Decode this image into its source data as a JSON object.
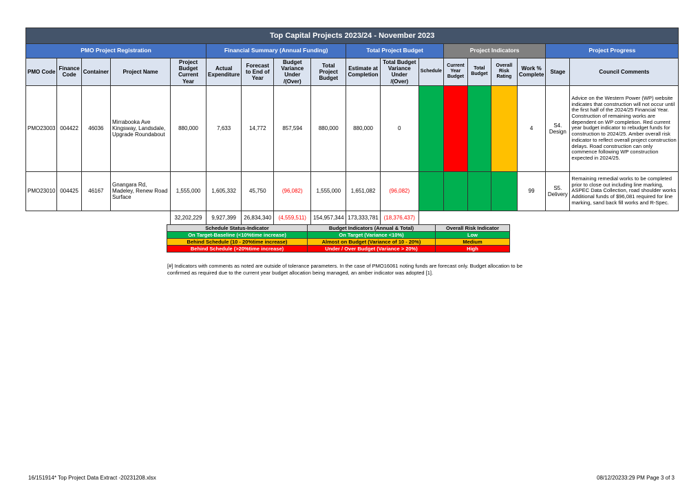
{
  "report": {
    "title": "Top Capital Projects 2023/24 - November 2023"
  },
  "groups": {
    "registration": "PMO Project Registration",
    "financial": "Financial Summary (Annual Funding)",
    "total_budget": "Total Project Budget",
    "indicators": "Project Indicators",
    "progress": "Project Progress"
  },
  "columns": {
    "pmo_code": "PMO Code",
    "finance_code": "Finance Code",
    "container": "Container",
    "project_name": "Project Name",
    "project_budget": "Project Budget Current Year",
    "actual_expenditure": "Actual Expenditure",
    "forecast": "Forecast to End of Year",
    "budget_variance": "Budget Variance Under /(Over)",
    "total_project_budget": "Total Project Budget",
    "estimate_completion": "Estimate at Completion",
    "total_budget_variance": "Total Budget Variance Under /(Over)",
    "schedule": "Schedule",
    "current_year_budget": "Current Year Budget",
    "total_budget": "Total Budget",
    "overall_risk": "Overall Risk Rating",
    "work_complete": "Work % Complete",
    "stage": "Stage",
    "council_comments": "Council Comments"
  },
  "colors": {
    "green": "#00b050",
    "red": "#ff0000",
    "amber": "#ffc000",
    "title_bg": "#44546a",
    "group_blue": "#4472c4",
    "group_grey": "#808080"
  },
  "rows": [
    {
      "pmo_code": "PMO23003",
      "finance_code": "004422",
      "container": "46036",
      "project_name": "Mirrabooka Ave Kingsway, Landsdale, Upgrade Roundabout",
      "project_budget": "880,000",
      "actual_expenditure": "7,633",
      "forecast": "14,772",
      "budget_variance": "857,594",
      "total_project_budget": "880,000",
      "estimate_completion": "880,000",
      "total_budget_variance": "0",
      "schedule": "green",
      "current_year_budget": "red",
      "total_budget": "green",
      "overall_risk": "amber",
      "work_complete": "4",
      "stage": "S4. Design",
      "comments": "Advice on the Western Power (WP) website indicates that construction will not occur until the first half of the 2024/25 Financial Year. Construction of remaining works are dependent on WP completion. Red current year budget indicator to rebudget funds for construction to 2024/25. Amber overall risk indicator to reflect overall project construction delays. Road construction can only commence following WP construction expected in 2024/25."
    },
    {
      "pmo_code": "PMO23010",
      "finance_code": "004425",
      "container": "46167",
      "project_name": "Gnangara Rd, Madeley, Renew Road Surface",
      "project_budget": "1,555,000",
      "actual_expenditure": "1,605,332",
      "forecast": "45,750",
      "budget_variance": "(96,082)",
      "total_project_budget": "1,555,000",
      "estimate_completion": "1,651,082",
      "total_budget_variance": "(96,082)",
      "schedule": "green",
      "current_year_budget": "green",
      "total_budget": "green",
      "overall_risk": "green",
      "work_complete": "99",
      "stage": "S5. Delivery",
      "comments": "Remaining remedial works to be completed prior to close out including line marking, ASPEC Data Collection, road shoulder works Additional funds of $96,081 required for line marking, sand back fill works and R-Spec."
    }
  ],
  "totals": {
    "project_budget": "32,202,229",
    "actual_expenditure": "9,927,399",
    "forecast": "26,834,340",
    "budget_variance": "(4,559,511)",
    "total_project_budget": "154,957,344",
    "estimate_completion": "173,333,781",
    "total_budget_variance": "(18,376,437)"
  },
  "legend": {
    "headers": [
      "Schedule Status-Indicator",
      "Budget Indicators (Annual & Total)",
      "Overall Risk Indicator"
    ],
    "green": [
      "On Target-Baseline (<10%time increase)",
      "On Target (Variance <10%)",
      "Low"
    ],
    "amber": [
      "Behind Schedule (10 - 20%time increase)",
      "Almost on Budget (Variance of 10 - 20%)",
      "Medium"
    ],
    "red": [
      "Behind Schedule (>20%time increase)",
      "Under / Over Budget (Variance > 20%)",
      "High"
    ]
  },
  "note": "[#] Indicators with comments as noted are outside of tolerance parameters. In the case of PMO16061 noting funds are forecast only. Budget allocation to be confirmed as required due to the current year budget allocation being managed, an amber indicator was adopted [1].",
  "footer": {
    "left": "16/151914*  Top Project Data Extract -20231208.xlsx",
    "right": "08/12/20233:29 PM   Page 3 of 3"
  }
}
